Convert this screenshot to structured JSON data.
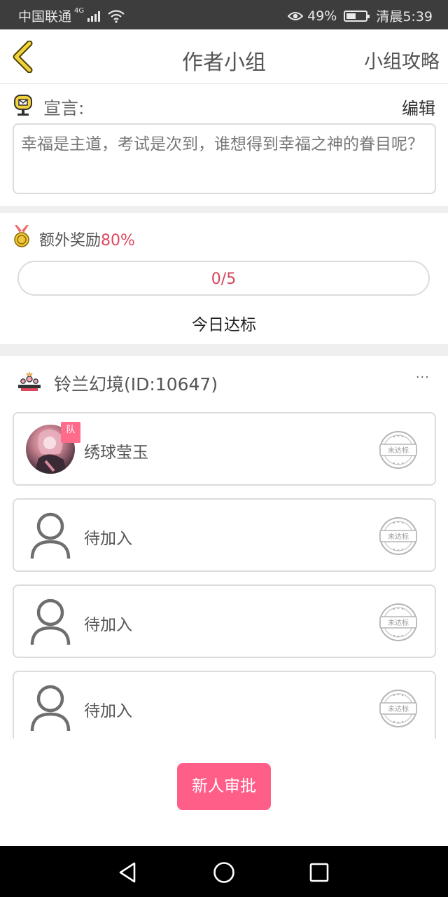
{
  "status_bar": {
    "carrier": "中国联通",
    "network_type": "4G",
    "battery_percent": "49%",
    "battery_level": 0.49,
    "time": "清晨5:39",
    "icons": [
      "signal-icon",
      "wifi-icon",
      "eye-icon",
      "battery-icon"
    ]
  },
  "header": {
    "back_icon": "chevron-left-icon",
    "title": "作者小组",
    "right_link": "小组攻略"
  },
  "motto": {
    "icon": "mailbox-icon",
    "label": "宣言:",
    "edit_label": "编辑",
    "text": "幸福是主道，考试是次到，谁想得到幸福之神的眷目呢？"
  },
  "reward": {
    "icon": "medal-icon",
    "label": "额外奖励",
    "percent": "80%",
    "progress_text": "0/5",
    "progress_current": 0,
    "progress_total": 5,
    "daily_label": "今日达标"
  },
  "group": {
    "icon": "group-icon",
    "name": "铃兰幻境(ID:10647)",
    "more_label": "···"
  },
  "members": [
    {
      "name": "绣球莹玉",
      "badge": "队",
      "avatar": "user-photo",
      "status": "未达标"
    },
    {
      "name": "待加入",
      "avatar": "default-avatar-icon",
      "status": "未达标"
    },
    {
      "name": "待加入",
      "avatar": "default-avatar-icon",
      "status": "未达标"
    },
    {
      "name": "待加入",
      "avatar": "default-avatar-icon",
      "status": "未达标"
    }
  ],
  "approve_button": "新人审批",
  "nav_bar": {
    "icons": [
      "back-triangle-icon",
      "home-circle-icon",
      "recents-square-icon"
    ]
  },
  "colors": {
    "accent": "#ff5e89",
    "highlight_text": "#e0475d",
    "status_bar_bg": "#3d3d3d",
    "nav_bar_bg": "#000000"
  }
}
